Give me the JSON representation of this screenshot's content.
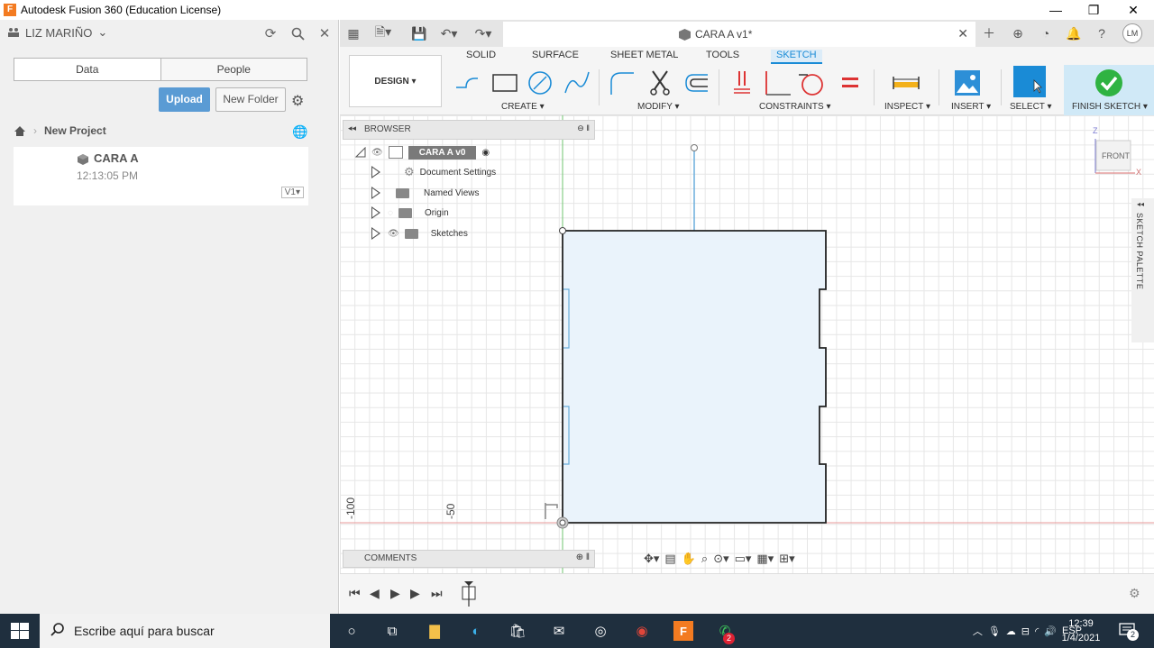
{
  "window": {
    "title": "Autodesk Fusion 360 (Education License)",
    "app_icon_letter": "F",
    "controls": [
      "—",
      "❐",
      "✕"
    ]
  },
  "data_panel": {
    "user": "LIZ MARIÑO",
    "tabs": [
      "Data",
      "People"
    ],
    "upload_label": "Upload",
    "new_folder_label": "New Folder",
    "breadcrumb": "New Project",
    "file": {
      "name": "CARA A",
      "time": "12:13:05 PM",
      "version": "V1▾"
    }
  },
  "doc_tab": {
    "title": "CARA A v1*"
  },
  "avatar_initials": "LM",
  "toolbar": {
    "tabs": [
      "SOLID",
      "SURFACE",
      "SHEET METAL",
      "TOOLS",
      "SKETCH"
    ],
    "active_tab": "SKETCH",
    "workspace": "DESIGN ▾",
    "groups": {
      "create": "CREATE ▾",
      "modify": "MODIFY ▾",
      "constraints": "CONSTRAINTS ▾",
      "inspect": "INSPECT ▾",
      "insert": "INSERT ▾",
      "select": "SELECT ▾",
      "finish": "FINISH SKETCH ▾"
    }
  },
  "browser": {
    "title": "BROWSER",
    "root": "CARA A v0",
    "items": [
      {
        "label": "Document Settings",
        "icon": "gear-icon"
      },
      {
        "label": "Named Views",
        "icon": "folder-icon"
      },
      {
        "label": "Origin",
        "icon": "folder-icon"
      },
      {
        "label": "Sketches",
        "icon": "folder-icon"
      }
    ]
  },
  "comments": {
    "title": "COMMENTS"
  },
  "viewcube": {
    "face": "FRONT",
    "axis_z": "Z",
    "axis_x": "X"
  },
  "sketch_palette": {
    "label": "SKETCH PALETTE"
  },
  "ruler": {
    "labels": [
      "-100",
      "-50"
    ]
  },
  "taskbar": {
    "search_placeholder": "Escribe aquí para buscar",
    "lang": "ESP",
    "time": "12:39",
    "date": "1/4/2021",
    "notification_count": "2"
  },
  "colors": {
    "accent": "#1a8bd6",
    "sketch_fill": "#eaf3fb",
    "finish_check": "#2fb342",
    "upload_button": "#5a9bd4"
  }
}
